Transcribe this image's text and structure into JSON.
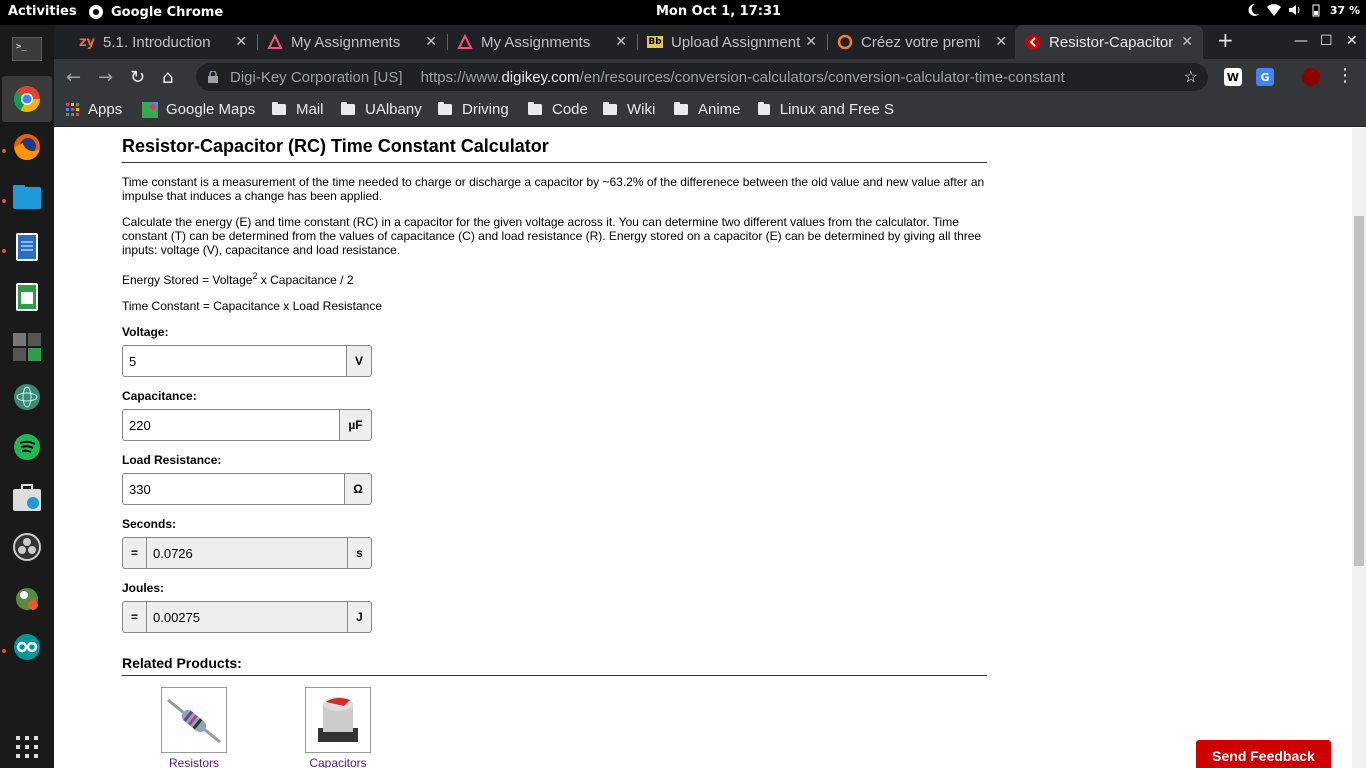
{
  "topbar": {
    "activities": "Activities",
    "app_name": "Google Chrome",
    "clock": "Mon Oct  1, 17:31",
    "battery": "37 %"
  },
  "dock": {
    "items": [
      "terminal-icon",
      "chrome-icon",
      "firefox-icon",
      "files-icon",
      "writer-icon",
      "calc-sheet-icon",
      "calculator-icon",
      "atom-icon",
      "spotify-icon",
      "software-icon",
      "obs-icon",
      "gimp-icon",
      "arduino-icon",
      "app-grid-icon"
    ]
  },
  "tabs": [
    {
      "title": "5.1. Introduction",
      "icon": "zybooks-icon"
    },
    {
      "title": "My Assignments",
      "icon": "mastery-icon"
    },
    {
      "title": "My Assignments",
      "icon": "mastery-icon"
    },
    {
      "title": "Upload Assignment",
      "icon": "blackboard-icon"
    },
    {
      "title": "Créez votre premi",
      "icon": "openclassrooms-icon"
    },
    {
      "title": "Resistor-Capacitor",
      "icon": "digikey-icon",
      "active": true
    }
  ],
  "omnibox": {
    "org": "Digi-Key Corporation [US]",
    "url_prefix": "https://www.",
    "url_domain": "digikey.com",
    "url_path": "/en/resources/conversion-calculators/conversion-calculator-time-constant"
  },
  "bookmarks": {
    "apps": "Apps",
    "items": [
      "Google Maps",
      "Mail",
      "UAlbany",
      "Driving",
      "Code",
      "Wiki",
      "Anime",
      "Linux and Free S"
    ]
  },
  "page": {
    "title": "Resistor-Capacitor (RC) Time Constant Calculator",
    "para1": "Time constant is a measurement of the time needed to charge or discharge a capacitor by ~63.2% of the differenece between the old value and new value after an impulse that induces a change has been applied.",
    "para2": "Calculate the energy (E) and time constant (RC) in a capacitor for the given voltage across it. You can determine two different values from the calculator. Time constant (T) can be determined from the values of capacitance (C) and load resistance (R). Energy stored on a capacitor (E) can be determined by giving all three inputs: voltage (V), capacitance and load resistance.",
    "formula1_a": "Energy Stored = Voltage",
    "formula1_sup": "2",
    "formula1_b": " x Capacitance / 2",
    "formula2": "Time Constant = Capacitance x Load Resistance",
    "voltage": {
      "label": "Voltage:",
      "value": "5",
      "unit": "V"
    },
    "capacitance": {
      "label": "Capacitance:",
      "value": "220",
      "unit": "µF"
    },
    "resistance": {
      "label": "Load Resistance:",
      "value": "330",
      "unit": "Ω"
    },
    "seconds": {
      "label": "Seconds:",
      "prefix": "=",
      "value": "0.0726",
      "unit": "s"
    },
    "joules": {
      "label": "Joules:",
      "prefix": "=",
      "value": "0.00275",
      "unit": "J"
    },
    "related_title": "Related Products:",
    "products": [
      "Resistors",
      "Capacitors"
    ],
    "feedback": "Send Feedback"
  }
}
